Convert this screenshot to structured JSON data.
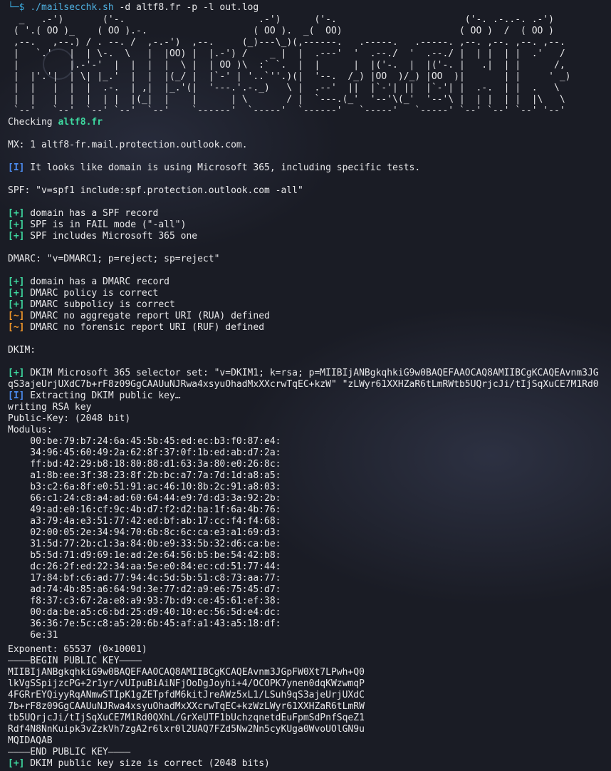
{
  "prompt": {
    "branch": "└─",
    "dollar": "$",
    "command": "./mailsecchk.sh",
    "args": " -d altf8.fr -p -l out.log"
  },
  "banner": [
    "  _   .-')       ('-.                        .-')      ('-.                       ('-. .-..-. .-')",
    " ( '.( OO )_    ( OO ).-.                   ( OO ).  _(  OO)                     ( OO )  /  ( OO )",
    " ,--.   ,--.) / . --. /  ,-.-')  ,--.     (_)---\\_)(,------.   .-----.   .-----. ,--. ,--. ,--. ,--.",
    " |   `.'   |  | \\-.  \\   |  |OO) |  |.-') /    _ |  |  .---'  '  .--./  '  .--./ |  | |  | |  .'   /",
    " |         |.-'-'  |  |  |  |  \\ |  | OO )\\  :` `.  |  |      |  |('-.  |  |('-. |   .|  | |      /,",
    " |  |'.'|  | \\| |_.'  |  |  |(_/ |  |`-' | '..`''.)(|  '--.  /_) |OO  )/_) |OO  )|       | |     ' _)",
    " |  |   |  |  |  .-.  | ,|  |_.'(|  '---.'.-._)   \\ |  .--'  ||  |`-'| ||  |`-'| |  .-.  | |  .   \\",
    " |  |   |  |  |  | |  |(_|  |    |      | \\       / |  `---.(_'  '--'\\(_'  '--'\\ |  | |  | |  |\\   \\",
    " `--'   `--'  `--' `--'  `--'    `------'  `-----'  `------'   `-----'   `-----' `--' `--' `--' '--'"
  ],
  "checking": {
    "label": "Checking ",
    "domain": "altf8.fr"
  },
  "mx": "MX: 1 altf8-fr.mail.protection.outlook.com.",
  "tags": {
    "plus": "[+]",
    "info": "[I]",
    "warn": "[~]"
  },
  "ms365_notice": " It looks like domain is using Microsoft 365, including specific tests.",
  "spf": {
    "record": "SPF: \"v=spf1 include:spf.protection.outlook.com -all\"",
    "results": [
      " domain has a SPF record",
      " SPF is in FAIL mode (\"-all\")",
      " SPF includes Microsoft 365 one"
    ]
  },
  "dmarc": {
    "record": "DMARC: \"v=DMARC1; p=reject; sp=reject\"",
    "results_ok": [
      " domain has a DMARC record",
      " DMARC policy is correct",
      " DMARC subpolicy is correct"
    ],
    "results_warn": [
      " DMARC no aggregate report URI (RUA) defined",
      " DMARC no forensic report URI (RUF) defined"
    ]
  },
  "dkim": {
    "header": "DKIM:",
    "selector_line": " DKIM Microsoft 365 selector set: \"v=DKIM1; k=rsa; p=MIIBIjANBgkqhkiG9w0BAQEFAAOCAQ8AMIIBCgKCAQEAvnm3JG",
    "selector_line2": "qS3ajeUrjUXdC7b+rF8z09GgCAAUuNJRwa4xsyuOhadMxXXcrwTqEC+kzW\" \"zLWyr61XXHZaR6tLmRWtb5UQrjcJi/tIjSqXuCE7M1Rd0",
    "extracting": " Extracting DKIM public key…",
    "writing": "writing RSA key",
    "public_key": "Public-Key: (2048 bit)",
    "modulus_label": "Modulus:",
    "modulus": [
      "    00:be:79:b7:24:6a:45:5b:45:ed:ec:b3:f0:87:e4:",
      "    34:96:45:60:49:2a:62:8f:37:0f:1b:ed:ab:d7:2a:",
      "    ff:bd:42:29:b8:18:80:88:d1:63:3a:80:e0:26:8c:",
      "    a1:8b:ee:3f:38:23:8f:2b:bc:a7:7a:7d:1d:a8:a5:",
      "    b3:c2:6a:8f:e0:51:91:ac:46:10:8b:2c:91:a8:03:",
      "    66:c1:24:c8:a4:ad:60:64:44:e9:7d:d3:3a:92:2b:",
      "    49:ad:e0:16:cf:9c:4b:d7:f2:d2:ba:1f:6a:4b:76:",
      "    a3:79:4a:e3:51:77:42:ed:bf:ab:17:cc:f4:f4:68:",
      "    02:00:05:2e:34:94:70:6b:8c:6c:ca:e3:a1:69:d3:",
      "    31:5d:77:2b:c1:3a:84:0b:e9:33:5b:32:d6:ca:be:",
      "    b5:5d:71:d9:69:1e:ad:2e:64:56:b5:be:54:42:b8:",
      "    dc:26:2f:ed:22:34:aa:5e:e0:84:ec:cd:51:77:44:",
      "    17:84:bf:c6:ad:77:94:4c:5d:5b:51:c8:73:aa:77:",
      "    ad:74:4b:85:a6:64:9d:3e:77:d2:a9:e6:75:45:d7:",
      "    f8:37:c3:67:2a:e8:a9:93:7b:d9:ce:45:61:ef:38:",
      "    00:da:be:a5:c6:bd:25:d9:40:10:ec:56:5d:e4:dc:",
      "    36:36:7e:5c:c8:a5:20:6b:45:af:a1:43:a5:18:df:",
      "    6e:31"
    ],
    "exponent": "Exponent: 65537 (0×10001)",
    "begin_key": "————BEGIN PUBLIC KEY————",
    "key_lines": [
      "MIIBIjANBgkqhkiG9w0BAQEFAAOCAQ8AMIIBCgKCAQEAvnm3JGpFW0Xt7LPwh+Q0",
      "lkVgSSpijzcPG+2r1yr/vUIpuBiAiNFjOoDgJoyhi+4/OCOPK7ynen0dqKWzwmqP",
      "4FGRrEYQiyyRqANmwSTIpK1gZETpfdM6kitJreAWz5xL1/LSuh9qS3ajeUrjUXdC",
      "7b+rF8z09GgCAAUuNJRwa4xsyuOhadMxXXcrwTqEC+kzWzLWyr61XXHZaR6tLmRW",
      "tb5UQrjcJi/tIjSqXuCE7M1Rd0QXhL/GrXeUTF1bUchzqnetdEuFpmSdPnfSqeZ1",
      "Rdf4N8NnKuipk3vZzkVh7zgA2r6lxr0l2UAQ7FZd5Nw2Nn5cyKUga0WvoUOlGN9u",
      "MQIDAQAB"
    ],
    "end_key": "————END PUBLIC KEY————",
    "size_result": " DKIM public key size is correct (2048 bits)"
  }
}
